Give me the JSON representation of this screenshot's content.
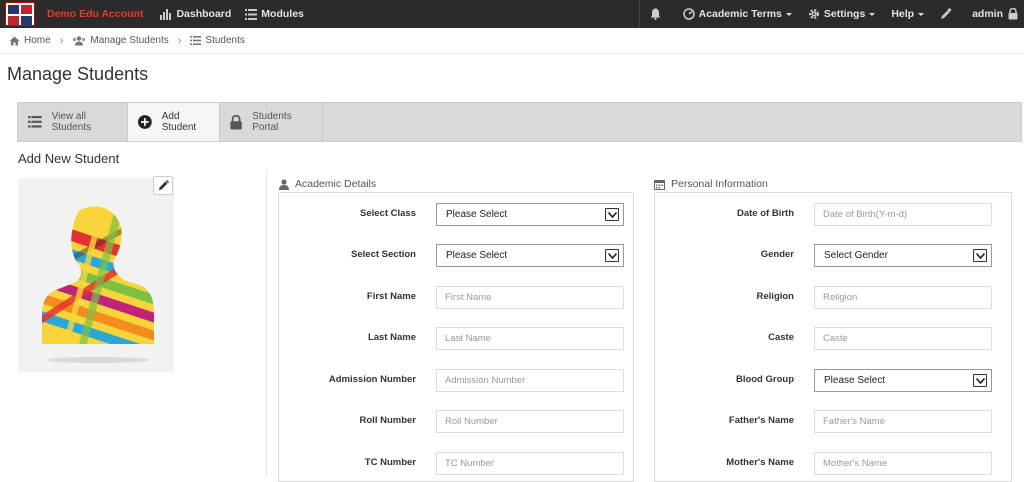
{
  "topbar": {
    "brand": "Demo Edu Account",
    "dashboard": "Dashboard",
    "modules": "Modules",
    "academic_terms": "Academic Terms",
    "settings": "Settings",
    "help": "Help",
    "user": "admin"
  },
  "breadcrumb": {
    "home": "Home",
    "manage_students": "Manage Students",
    "students": "Students"
  },
  "page_title": "Manage Students",
  "tabs": [
    {
      "label": "View all Students"
    },
    {
      "label": "Add Student"
    },
    {
      "label": "Students Portal"
    }
  ],
  "section_title": "Add New Student",
  "academic": {
    "heading": "Academic Details",
    "select_class": {
      "label": "Select Class",
      "value": "Please Select"
    },
    "select_section": {
      "label": "Select Section",
      "value": "Please Select"
    },
    "first_name": {
      "label": "First Name",
      "placeholder": "First Name"
    },
    "last_name": {
      "label": "Last Name",
      "placeholder": "Last Name"
    },
    "admission_number": {
      "label": "Admission Number",
      "placeholder": "Admission Number"
    },
    "roll_number": {
      "label": "Roll Number",
      "placeholder": "Roll Number"
    },
    "tc_number": {
      "label": "TC Number",
      "placeholder": "TC Number"
    }
  },
  "personal": {
    "heading": "Personal Information",
    "dob": {
      "label": "Date of Birth",
      "placeholder": "Date of Birth(Y-m-d)"
    },
    "gender": {
      "label": "Gender",
      "value": "Select Gender"
    },
    "religion": {
      "label": "Religion",
      "placeholder": "Religion"
    },
    "caste": {
      "label": "Caste",
      "placeholder": "Caste"
    },
    "blood_group": {
      "label": "Blood Group",
      "value": "Please Select"
    },
    "fathers_name": {
      "label": "Father's Name",
      "placeholder": "Father's Name"
    },
    "mothers_name": {
      "label": "Mother's Name",
      "placeholder": "Mother's Name"
    }
  },
  "colors": {
    "topbar_bg": "#2b2b2b",
    "brand": "#e83a2e",
    "tabbar_bg": "#d9d9d9"
  }
}
